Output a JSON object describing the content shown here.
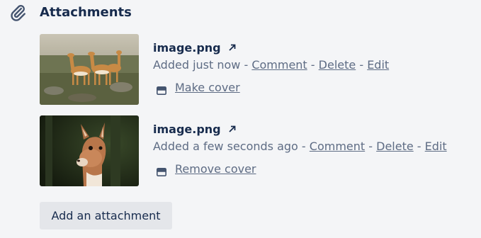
{
  "section": {
    "title": "Attachments",
    "icon": "paperclip-icon"
  },
  "attachments": [
    {
      "filename": "image.png",
      "added": "Added just now",
      "sep1": " - ",
      "comment": "Comment",
      "sep2": " - ",
      "delete": "Delete",
      "sep3": " - ",
      "edit": "Edit",
      "cover_action": "Make cover",
      "thumbnail": "vicunas-herd-photo"
    },
    {
      "filename": "image.png",
      "added": "Added a few seconds ago",
      "sep1": " - ",
      "comment": "Comment",
      "sep2": " - ",
      "delete": "Delete",
      "sep3": " - ",
      "edit": "Edit",
      "cover_action": "Remove cover",
      "thumbnail": "vicuna-portrait-photo"
    }
  ],
  "add_button": "Add an attachment",
  "colors": {
    "background": "#f4f5f7",
    "text_primary": "#172b4d",
    "text_secondary": "#5e6c84",
    "button_bg": "#e4e6ea"
  }
}
